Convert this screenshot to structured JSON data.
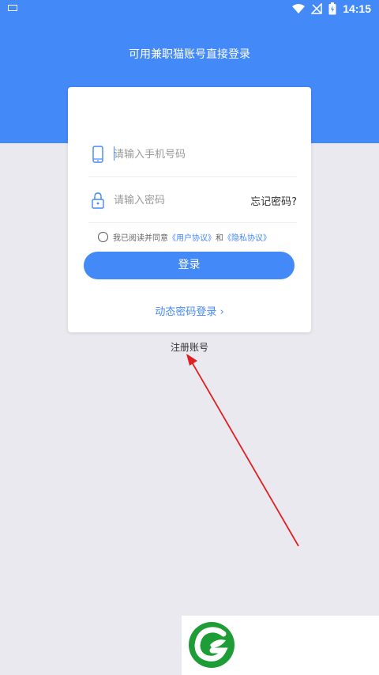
{
  "status_bar": {
    "time": "14:15"
  },
  "header": {
    "title": "可用兼职猫账号直接登录"
  },
  "login_form": {
    "phone_placeholder": "请输入手机号码",
    "password_placeholder": "请输入密码",
    "forgot_password": "忘记密码?",
    "agreement_prefix": "我已阅读并同意",
    "user_agreement": "《用户协议》",
    "agreement_and": "和",
    "privacy_agreement": "《隐私协议》",
    "login_button": "登录",
    "dynamic_password_login": "动态密码登录",
    "dynamic_chevron": "›"
  },
  "register": {
    "label": "注册账号"
  },
  "colors": {
    "primary": "#4389f8",
    "background": "#e9e9ef",
    "annotation_arrow": "#e02020",
    "logo_green": "#1e9c35"
  },
  "icons": {
    "phone": "phone-icon",
    "lock": "lock-icon",
    "wifi": "wifi-icon",
    "battery": "battery-icon",
    "signal_off": "no-signal-icon",
    "keyboard": "keyboard-icon",
    "logo": "leaf-logo"
  }
}
